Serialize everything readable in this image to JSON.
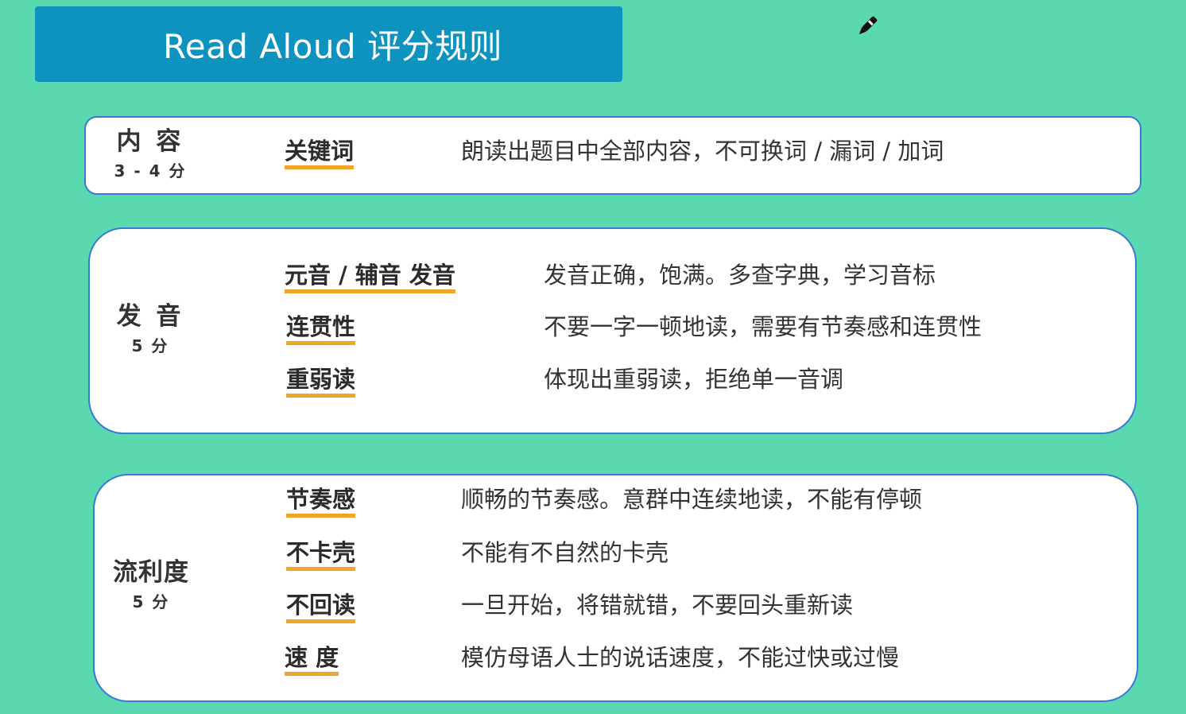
{
  "title": "Read Aloud 评分规则",
  "icons": {
    "pen": "pen-icon"
  },
  "colors": {
    "background": "#5AD9B1",
    "title_bg": "#0E93BF",
    "card_border": "#3A78D8",
    "underline": "#F2A428"
  },
  "sections": [
    {
      "name": "内 容",
      "score": "3 - 4 分",
      "rows": [
        {
          "keyword": "关键词",
          "desc": "朗读出题目中全部内容，不可换词 / 漏词 / 加词"
        }
      ]
    },
    {
      "name": "发 音",
      "score": "5 分",
      "rows": [
        {
          "keyword": "元音 / 辅音 发音",
          "desc": "发音正确，饱满。多查字典，学习音标"
        },
        {
          "keyword": "连贯性",
          "desc": "不要一字一顿地读，需要有节奏感和连贯性"
        },
        {
          "keyword": "重弱读",
          "desc": "体现出重弱读，拒绝单一音调"
        }
      ]
    },
    {
      "name": "流利度",
      "score": "5 分",
      "rows": [
        {
          "keyword": "节奏感",
          "desc": "顺畅的节奏感。意群中连续地读，不能有停顿"
        },
        {
          "keyword": "不卡壳",
          "desc": "不能有不自然的卡壳"
        },
        {
          "keyword": "不回读",
          "desc": "一旦开始，将错就错，不要回头重新读"
        },
        {
          "keyword": "速 度",
          "desc": "模仿母语人士的说话速度，不能过快或过慢"
        }
      ]
    }
  ]
}
